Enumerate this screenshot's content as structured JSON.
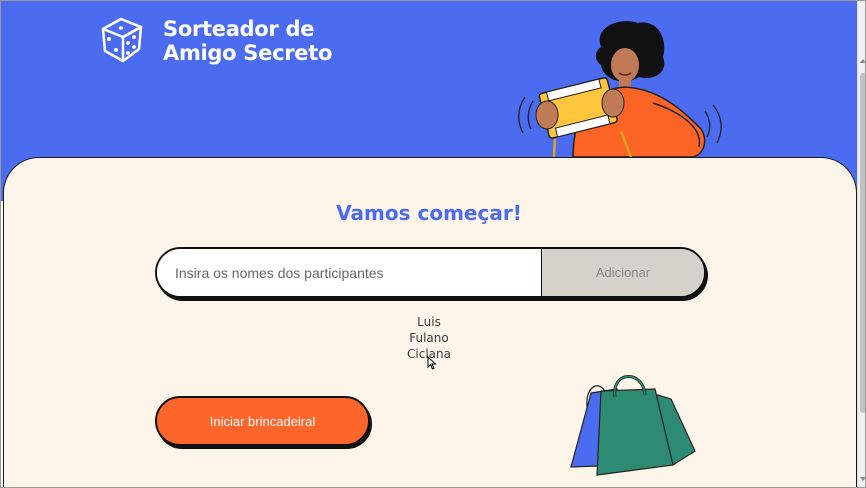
{
  "header": {
    "logo_line1": "Sorteador de",
    "logo_line2": "Amigo Secreto",
    "logo_icon": "dice-icon",
    "illustration": "person-with-gift-illustration"
  },
  "main": {
    "title": "Vamos começar!",
    "input_placeholder": "Insira os nomes dos participantes",
    "input_value": "",
    "add_button_label": "Adicionar",
    "participants": [
      "Luis",
      "Fulano",
      "Ciclana"
    ],
    "start_button_label": "Iniciar brincadeiral",
    "bag_illustration": "shopping-bag-illustration"
  },
  "colors": {
    "header_blue": "#4b6cf0",
    "cream": "#fdf5ea",
    "orange": "#fe652b",
    "button_gray": "#d6d1cb",
    "bag_green": "#2e8b73"
  }
}
